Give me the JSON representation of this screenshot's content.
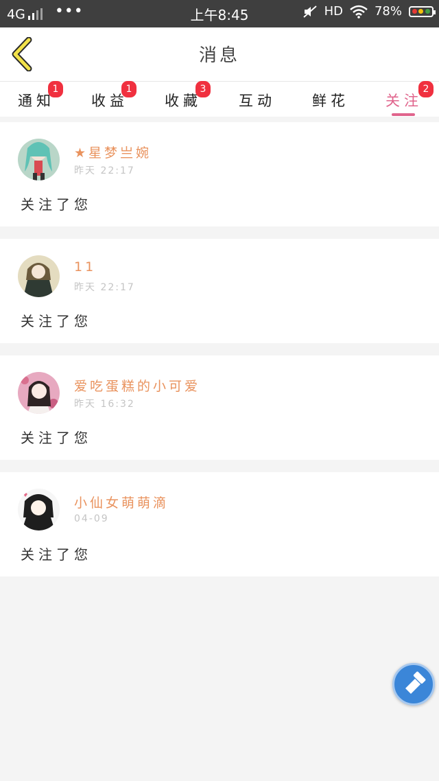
{
  "status_bar": {
    "network": "4G",
    "time": "上午8:45",
    "hd": "HD",
    "battery": "78%"
  },
  "header": {
    "title": "消息"
  },
  "tabs": [
    {
      "label": "通知",
      "badge": "1"
    },
    {
      "label": "收益",
      "badge": "1"
    },
    {
      "label": "收藏",
      "badge": "3"
    },
    {
      "label": "互动",
      "badge": ""
    },
    {
      "label": "鲜花",
      "badge": ""
    },
    {
      "label": "关注",
      "badge": "2",
      "active": true
    }
  ],
  "notifications": [
    {
      "name": "★星梦亗婉",
      "time": "昨天 22:17",
      "action": "关注了您"
    },
    {
      "name": "11",
      "time": "昨天 22:17",
      "action": "关注了您"
    },
    {
      "name": "爱吃蛋糕的小可爱",
      "time": "昨天 16:32",
      "action": "关注了您"
    },
    {
      "name": "小仙女萌萌滴",
      "time": "04-09",
      "action": "关注了您"
    }
  ],
  "colors": {
    "accent": "#e0648c",
    "name": "#e9925d",
    "badge": "#f0303f",
    "fab": "#3b86d8"
  }
}
